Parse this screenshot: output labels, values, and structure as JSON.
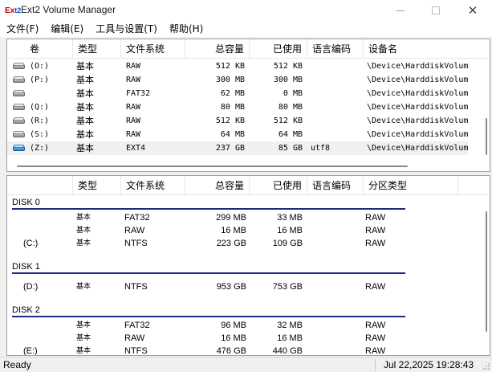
{
  "window": {
    "title": "Ext2 Volume Manager",
    "icon_text_a": "Ex",
    "icon_text_b": "t2"
  },
  "menu": [
    "文件(F)",
    "编辑(E)",
    "工具与设置(T)",
    "帮助(H)"
  ],
  "volumes": {
    "columns": [
      "卷",
      "类型",
      "文件系统",
      "总容量",
      "已使用",
      "语言编码",
      "设备名"
    ],
    "rows": [
      {
        "vol": "(O:)",
        "type": "基本",
        "fs": "RAW",
        "total": "512 KB",
        "used": "512 KB",
        "codepage": "",
        "device": "\\Device\\HarddiskVolum",
        "icon": "hard-disk-icon"
      },
      {
        "vol": "(P:)",
        "type": "基本",
        "fs": "RAW",
        "total": "300 MB",
        "used": "300 MB",
        "codepage": "",
        "device": "\\Device\\HarddiskVolum",
        "icon": "hard-disk-icon"
      },
      {
        "vol": "",
        "type": "基本",
        "fs": "FAT32",
        "total": "62 MB",
        "used": "0 MB",
        "codepage": "",
        "device": "\\Device\\HarddiskVolum",
        "icon": "hard-disk-icon"
      },
      {
        "vol": "(Q:)",
        "type": "基本",
        "fs": "RAW",
        "total": "80 MB",
        "used": "80 MB",
        "codepage": "",
        "device": "\\Device\\HarddiskVolum",
        "icon": "hard-disk-icon"
      },
      {
        "vol": "(R:)",
        "type": "基本",
        "fs": "RAW",
        "total": "512 KB",
        "used": "512 KB",
        "codepage": "",
        "device": "\\Device\\HarddiskVolum",
        "icon": "hard-disk-icon"
      },
      {
        "vol": "(S:)",
        "type": "基本",
        "fs": "RAW",
        "total": "64 MB",
        "used": "64 MB",
        "codepage": "",
        "device": "\\Device\\HarddiskVolum",
        "icon": "hard-disk-icon"
      },
      {
        "vol": "(Z:)",
        "type": "基本",
        "fs": "EXT4",
        "total": "237 GB",
        "used": "85 GB",
        "codepage": "utf8",
        "device": "\\Device\\HarddiskVolum",
        "icon": "ext-disk-icon"
      }
    ]
  },
  "disks": {
    "columns": [
      "",
      "类型",
      "文件系统",
      "总容量",
      "已使用",
      "语言编码",
      "分区类型"
    ],
    "groups": [
      {
        "name": "DISK 0",
        "partitions": [
          {
            "vol": "",
            "type": "基本",
            "fs": "FAT32",
            "total": "299 MB",
            "used": "33 MB",
            "codepage": "",
            "ptype": "RAW"
          },
          {
            "vol": "",
            "type": "基本",
            "fs": "RAW",
            "total": "16 MB",
            "used": "16 MB",
            "codepage": "",
            "ptype": "RAW"
          },
          {
            "vol": "(C:)",
            "type": "基本",
            "fs": "NTFS",
            "total": "223 GB",
            "used": "109 GB",
            "codepage": "",
            "ptype": "RAW"
          }
        ]
      },
      {
        "name": "DISK 1",
        "partitions": [
          {
            "vol": "(D:)",
            "type": "基本",
            "fs": "NTFS",
            "total": "953 GB",
            "used": "753 GB",
            "codepage": "",
            "ptype": "RAW"
          }
        ]
      },
      {
        "name": "DISK 2",
        "partitions": [
          {
            "vol": "",
            "type": "基本",
            "fs": "FAT32",
            "total": "96 MB",
            "used": "32 MB",
            "codepage": "",
            "ptype": "RAW"
          },
          {
            "vol": "",
            "type": "基本",
            "fs": "RAW",
            "total": "16 MB",
            "used": "16 MB",
            "codepage": "",
            "ptype": "RAW"
          },
          {
            "vol": "(E:)",
            "type": "基本",
            "fs": "NTFS",
            "total": "476 GB",
            "used": "440 GB",
            "codepage": "",
            "ptype": "RAW"
          }
        ]
      }
    ]
  },
  "status": {
    "left": "Ready",
    "right": "Jul 22,2025 19:28:43"
  }
}
